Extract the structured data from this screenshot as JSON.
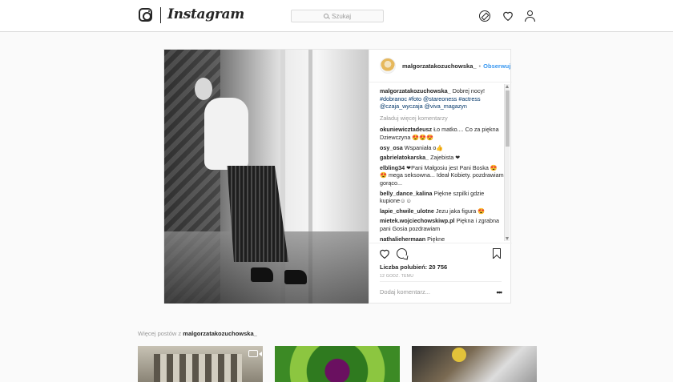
{
  "header": {
    "logo_text": "Instagram",
    "search_placeholder": "Szukaj"
  },
  "post": {
    "username": "malgorzatakozuchowska_",
    "follow_label": "Obserwuj",
    "caption": {
      "user": "malgorzatakozuchowska_",
      "text": "Dobrej nocy!",
      "tags": "#dobranoc #foto @stareoness #actress @czaja_wyczaja @viva_magazyn"
    },
    "load_more": "Załaduj więcej komentarzy",
    "comments": [
      {
        "user": "okuniewicztadeusz",
        "text": "Ło matko.... Co za piękna Dziewczyna 😍😍😍"
      },
      {
        "user": "osy_osa",
        "text": "Wspaniała o👍"
      },
      {
        "user": "gabrielatokarska_",
        "text": "Zajebista ❤"
      },
      {
        "user": "elbling34",
        "text": "❤Pani Małgosiu jest Pani Boska 😍😍 mega seksowna... Ideał Kobiety. pozdrawiam gorąco..."
      },
      {
        "user": "belly_dance_kalina",
        "text": "Piękne szpilki gdzie kupione☺☺"
      },
      {
        "user": "lapie_chwile_ulotne",
        "text": "Jezu jaka figura 😍"
      },
      {
        "user": "mietek.wojciechowskiwp.pl",
        "text": "Piękna i zgrabna pani Gosia pozdrawiam"
      },
      {
        "user": "nathaliehermaan",
        "text": "Piękne"
      }
    ],
    "likes": "Liczba polubień: 20 756",
    "timestamp": "12 GODZ. TEMU",
    "comment_placeholder": "Dodaj komentarz...",
    "more_options": "•••"
  },
  "more_posts": {
    "prefix": "Więcej postów z",
    "user": "malgorzatakozuchowska_"
  }
}
